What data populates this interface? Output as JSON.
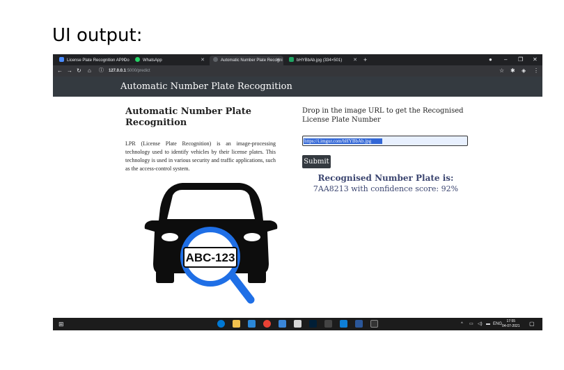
{
  "slide_title": "UI output:",
  "browser": {
    "tabs": [
      {
        "label": "License Plate Recognition API Do",
        "icon": "blue-triangle-icon",
        "color": "#4a8cff",
        "active": false
      },
      {
        "label": "WhatsApp",
        "icon": "whatsapp-icon",
        "color": "#25d366",
        "active": false
      },
      {
        "label": "Automatic Number Plate Recogni",
        "icon": "page-icon",
        "color": "#5f6368",
        "active": true
      },
      {
        "label": "bHYBbAb.jpg (334×501)",
        "icon": "image-icon",
        "color": "#1fa463",
        "active": false
      }
    ],
    "new_tab": "+",
    "address": {
      "host": "127.0.0.1",
      "path": ":5000/predict"
    }
  },
  "page": {
    "brand": "Automatic Number Plate Recognition",
    "heading": "Automatic Number Plate Recognition",
    "description": "LPR (License Plate Recognition) is an image-processing technology used to identify vehicles by their license plates. This technology is used in various security and traffic applications, such as the access-control system.",
    "plate_text": "ABC-123",
    "drop_label": "Drop in the image URL to get the Recognised License Plate Number",
    "url_value": "https://i.imgur.com/bHYBbAb.jpg",
    "submit_label": "Submit",
    "result_heading": "Recognised Number Plate is:",
    "result_value": "7AA8213 with confidence score: 92%"
  },
  "taskbar": {
    "lang": "ENG",
    "time": "17:55",
    "date": "04-07-2021"
  }
}
